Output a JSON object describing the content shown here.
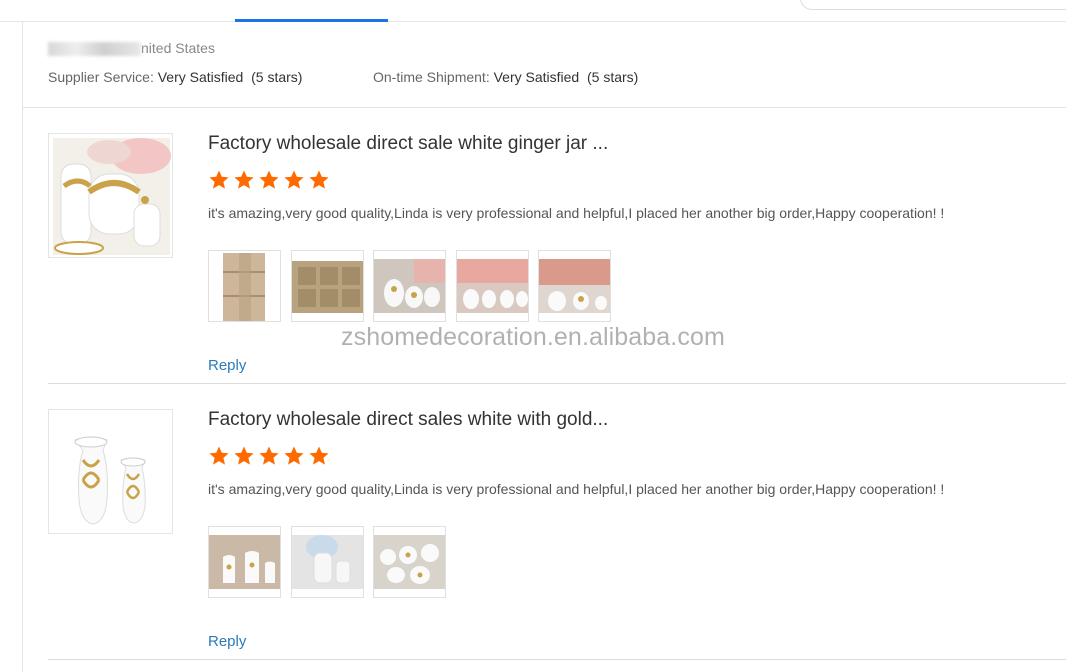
{
  "supplier": {
    "country": "nited States",
    "supplier_service_label": "Supplier Service:",
    "supplier_service_value": "Very Satisfied",
    "supplier_service_stars": "(5 stars)",
    "ontime_label": "On-time Shipment:",
    "ontime_value": "Very Satisfied",
    "ontime_stars": "(5 stars)"
  },
  "reviews": [
    {
      "title": "Factory wholesale direct sale white ginger jar ...",
      "rating": 5,
      "comment": "it's amazing,very good quality,Linda is very professional and helpful,I placed her another big order,Happy cooperation! !",
      "photo_count": 5,
      "reply_label": "Reply"
    },
    {
      "title": "Factory wholesale direct sales white with gold...",
      "rating": 5,
      "comment": "it's amazing,very good quality,Linda is very professional and helpful,I placed her another big order,Happy cooperation! !",
      "photo_count": 3,
      "reply_label": "Reply"
    }
  ],
  "watermark": "zshomedecoration.en.alibaba.com",
  "colors": {
    "star": "#ff6a00",
    "reply_link": "#2b7bb9",
    "active_tab": "#1a73e8"
  },
  "icons": {
    "star": "star-icon"
  }
}
